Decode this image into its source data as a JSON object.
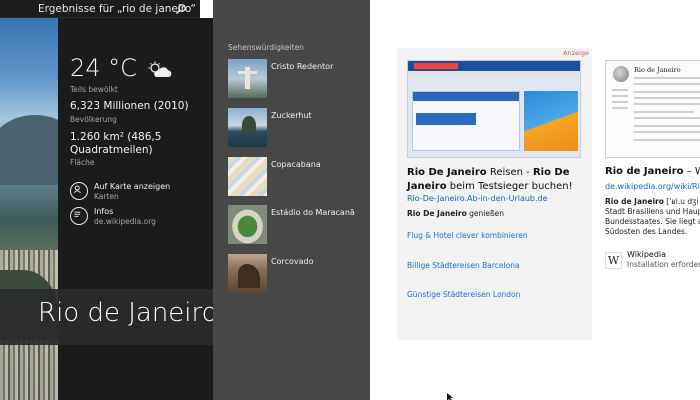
{
  "search": {
    "query_text": "Ergebnisse für „rio de janeiro“"
  },
  "info": {
    "temperature": "24 °C",
    "condition": "Teils bewölkt",
    "population_value": "6,323 Millionen (2010)",
    "population_label": "Bevölkerung",
    "area_value": "1.260 km² (486,5 Quadratmeilen)",
    "area_label": "Fläche",
    "map_link_title": "Auf Karte anzeigen",
    "map_link_sub": "Karten",
    "info_link_title": "Infos",
    "info_link_sub": "de.wikipedia.org"
  },
  "city_title": "Rio de Janeiro",
  "sights": {
    "header": "Sehenswürdigkeiten",
    "items": [
      {
        "label": "Cristo Redentor"
      },
      {
        "label": "Zuckerhut"
      },
      {
        "label": "Copacabana"
      },
      {
        "label": "Estádio do Maracanã"
      },
      {
        "label": "Corcovado"
      }
    ]
  },
  "ad": {
    "tag": "Anzeige",
    "title_bold_1": "Rio De Janeiro",
    "title_plain_1": " Reisen - ",
    "title_bold_2": "Rio De Janeiro",
    "title_plain_2": " beim Testsieger buchen!",
    "url": "Rio-De-Janeiro.Ab-in-den-Urlaub.de",
    "desc_bold": "Rio De Janeiro",
    "desc_plain": " genießen",
    "links": [
      "Flug & Hotel clever kombinieren",
      "Billige Städtereisen Barcelona",
      "Günstige Städtereisen London"
    ]
  },
  "wiki": {
    "shot_title": "Rio de Janeiro",
    "title_bold": "Rio de Janeiro",
    "title_plain": " – Wiki",
    "url": "de.wikipedia.org/wiki/Rio_de_",
    "desc_bold": "Rio de Janeiro",
    "desc_plain": " [ˈʁi.u dʒi ʒaˈ Stadt Brasiliens und Hauptsta Bundesstaates. Sie liegt an der Südosten des Landes.",
    "logo_letter": "W",
    "source_name": "Wikipedia",
    "source_sub": "Installation erforderlic"
  },
  "colors": {
    "dark_panel": "#1b1b1b",
    "sights_panel": "#474747",
    "link_blue": "#1565c0",
    "ad_tag": "#c9606a"
  }
}
